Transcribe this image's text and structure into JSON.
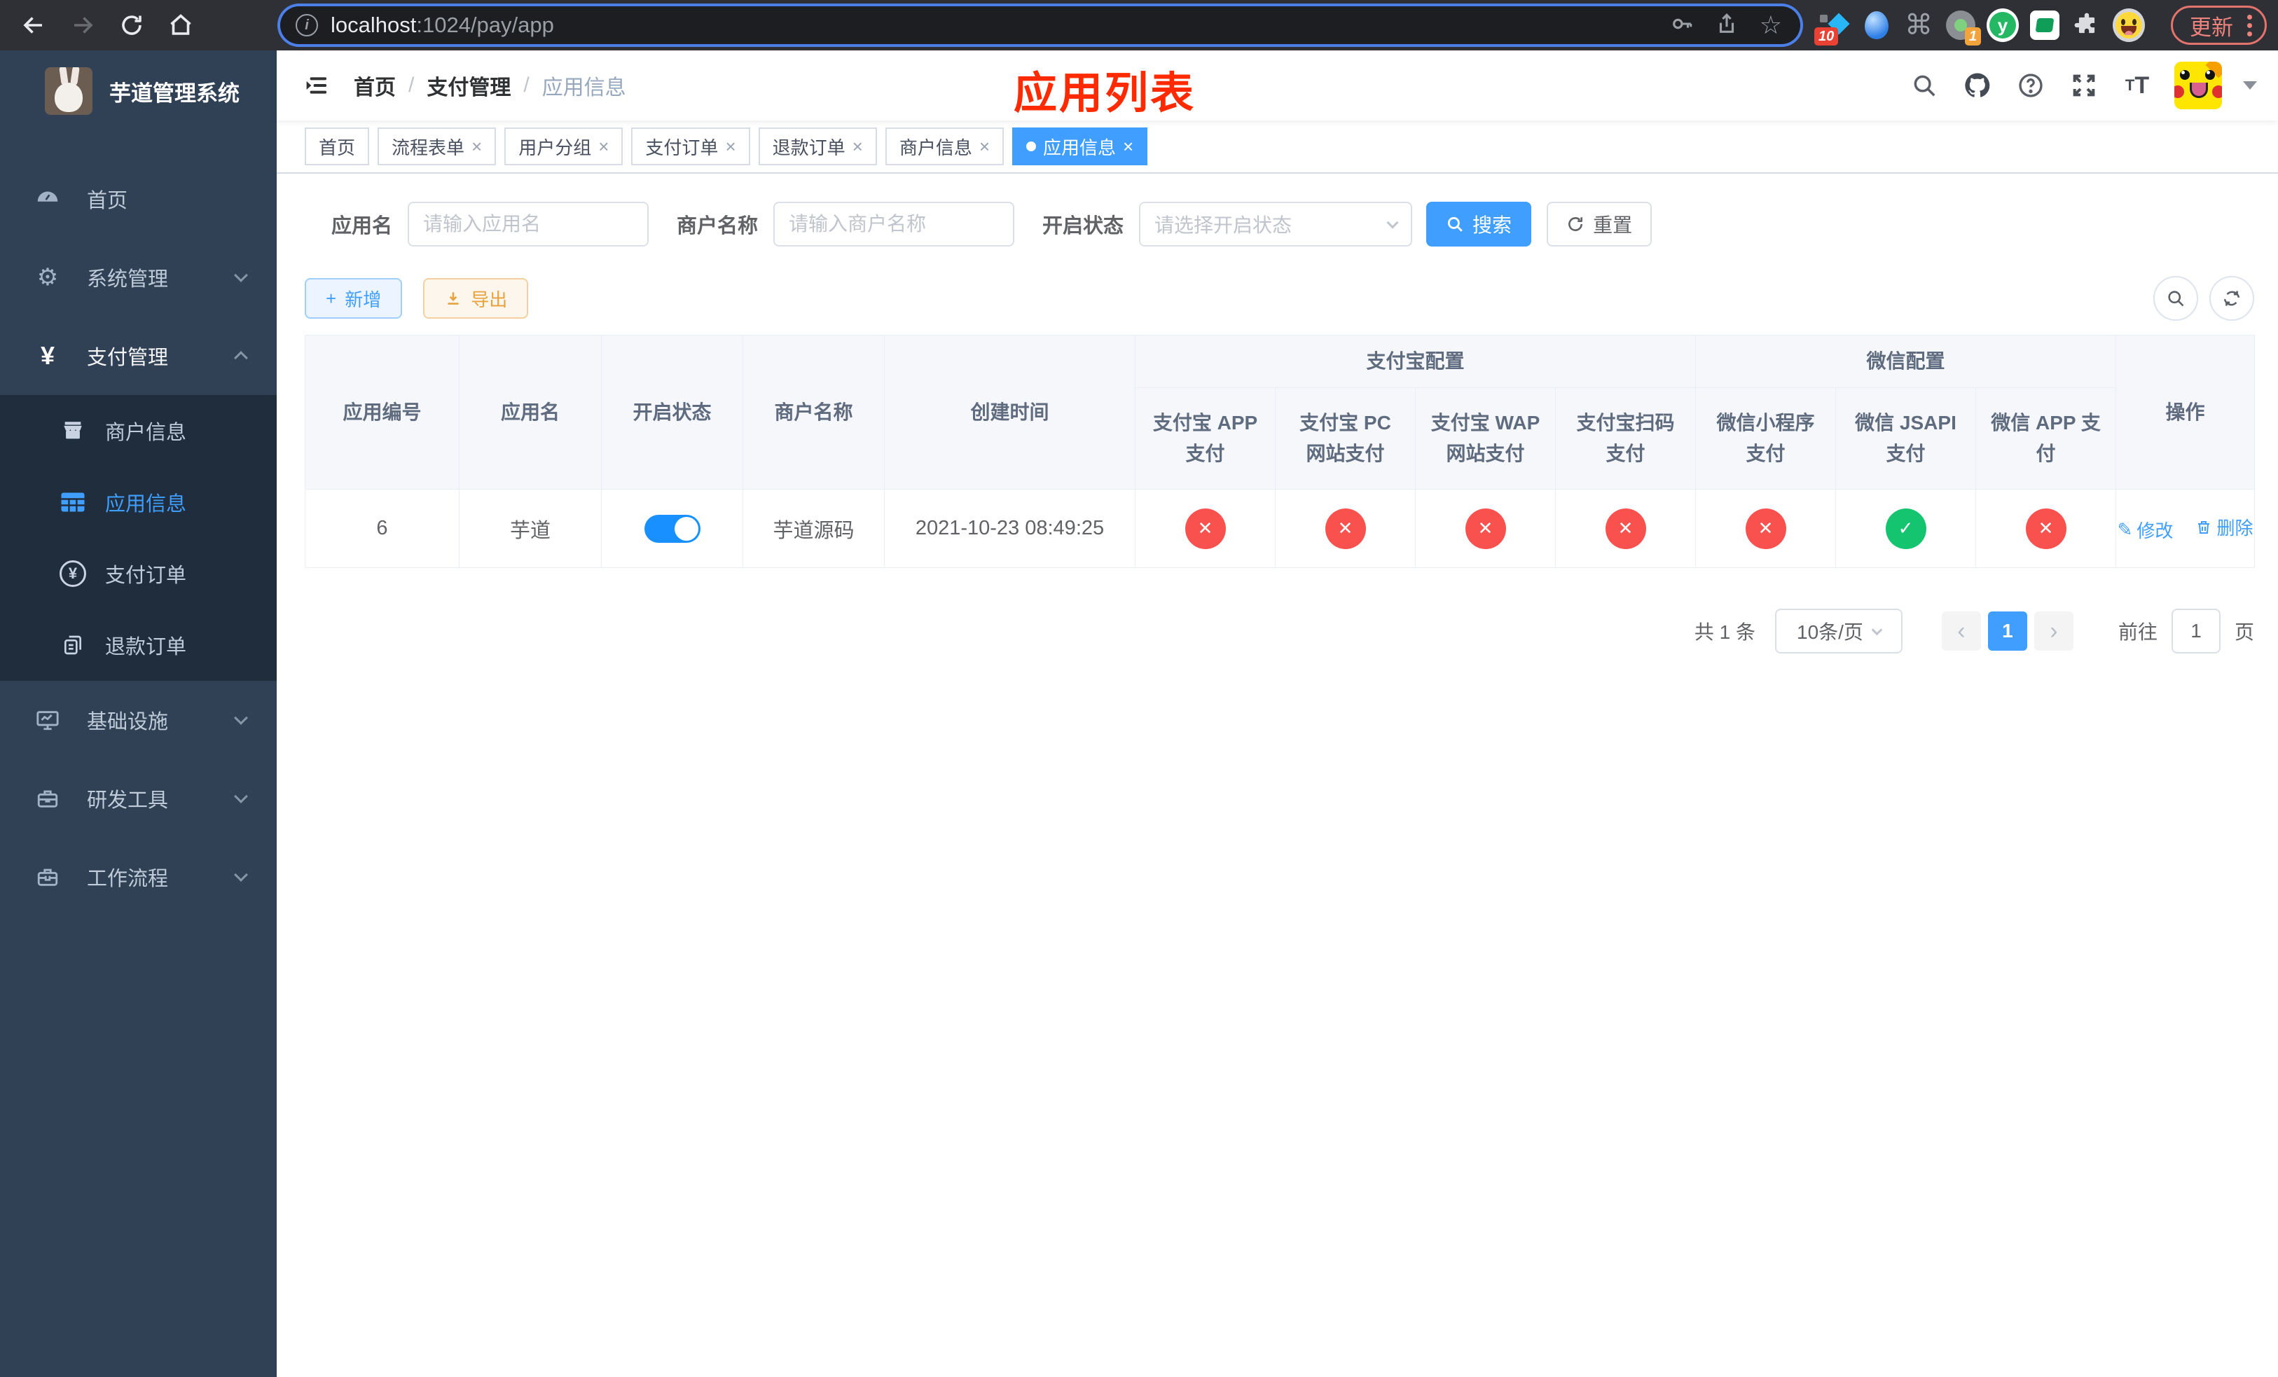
{
  "colors": {
    "primary": "#409eff",
    "switch_on": "#1890ff",
    "danger": "#f9524e",
    "success": "#15c46f",
    "annotation": "#ff2a00",
    "sidebar_bg": "#304156",
    "submenu_bg": "#1f2d3d",
    "warning": "#e6a23c"
  },
  "icons": {
    "gear": "⚙",
    "yen": "¥",
    "cmd": "⌘",
    "star": "☆",
    "close": "×",
    "plus": "+",
    "pen": "✎",
    "prev": "‹",
    "next": "›",
    "info": "i",
    "question": "?",
    "t_small": "T",
    "t_big": "T",
    "check": "✓",
    "cross": "✕"
  },
  "browser": {
    "url_host": "localhost",
    "url_rest": ":1024/pay/app",
    "update_label": "更新",
    "ext_badge_blue": "10",
    "ext_badge_gray": "1",
    "yuque_letter": "y"
  },
  "sidebar": {
    "title": "芋道管理系统",
    "menu": [
      {
        "label": "首页"
      },
      {
        "label": "系统管理"
      },
      {
        "label": "支付管理"
      },
      {
        "label": "商户信息"
      },
      {
        "label": "应用信息"
      },
      {
        "label": "支付订单"
      },
      {
        "label": "退款订单"
      },
      {
        "label": "基础设施"
      },
      {
        "label": "研发工具"
      },
      {
        "label": "工作流程"
      }
    ]
  },
  "navbar": {
    "breadcrumb": [
      "首页",
      "支付管理",
      "应用信息"
    ],
    "separator": "/",
    "annotation": "应用列表"
  },
  "tabs": [
    {
      "label": "首页"
    },
    {
      "label": "流程表单"
    },
    {
      "label": "用户分组"
    },
    {
      "label": "支付订单"
    },
    {
      "label": "退款订单"
    },
    {
      "label": "商户信息"
    },
    {
      "label": "应用信息"
    }
  ],
  "filters": {
    "app_name_label": "应用名",
    "app_name_placeholder": "请输入应用名",
    "merchant_label": "商户名称",
    "merchant_placeholder": "请输入商户名称",
    "status_label": "开启状态",
    "status_placeholder": "请选择开启状态",
    "search_label": "搜索",
    "reset_label": "重置"
  },
  "toolbar": {
    "add_label": "新增",
    "export_label": "导出"
  },
  "table": {
    "columns": [
      "应用编号",
      "应用名",
      "开启状态",
      "商户名称",
      "创建时间"
    ],
    "groups": [
      "支付宝配置",
      "微信配置"
    ],
    "subcols": [
      "支付宝 APP 支付",
      "支付宝 PC 网站支付",
      "支付宝 WAP 网站支付",
      "支付宝扫码支付",
      "微信小程序支付",
      "微信 JSAPI 支付",
      "微信 APP 支付"
    ],
    "op_col": "操作",
    "row": {
      "app_id": "6",
      "app_name": "芋道",
      "switch_on": true,
      "merchant": "芋道源码",
      "create_time": "2021-10-23 08:49:25",
      "status_glyphs": [
        "✕",
        "✕",
        "✕",
        "✕",
        "✕",
        "✓",
        "✕"
      ],
      "status_colors": [
        "#f9524e",
        "#f9524e",
        "#f9524e",
        "#f9524e",
        "#f9524e",
        "#15c46f",
        "#f9524e"
      ],
      "edit_label": "修改",
      "delete_label": "删除"
    }
  },
  "pagination": {
    "total": "共 1 条",
    "page_size": "10条/页",
    "page": "1",
    "goto_label": "前往",
    "goto_value": "1",
    "unit_label": "页"
  }
}
